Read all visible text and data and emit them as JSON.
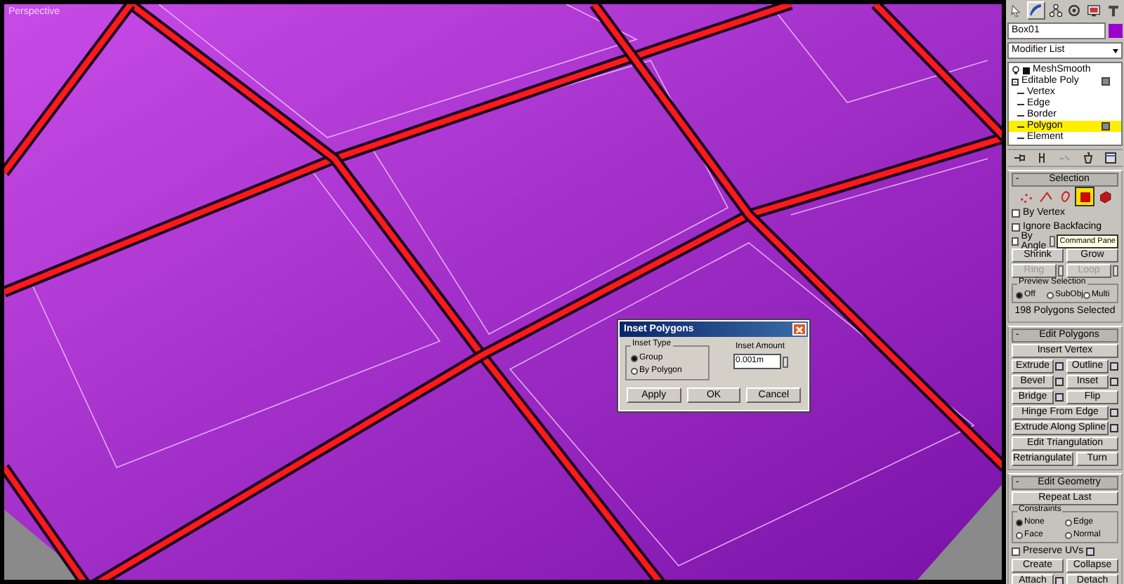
{
  "viewport": {
    "label": "Perspective"
  },
  "command_panel": {
    "tabs": [
      {
        "kind": "create",
        "selected": false
      },
      {
        "kind": "modify",
        "selected": true
      },
      {
        "kind": "hierarchy",
        "selected": false
      },
      {
        "kind": "motion",
        "selected": false
      },
      {
        "kind": "display",
        "selected": false
      },
      {
        "kind": "utilities",
        "selected": false
      }
    ],
    "object_name": "Box01",
    "modifier_list": "Modifier List",
    "stack": [
      {
        "label": "MeshSmooth",
        "kind": "modifier"
      },
      {
        "label": "Editable Poly",
        "kind": "base",
        "expanded": true,
        "children": [
          {
            "label": "Vertex",
            "selected": false
          },
          {
            "label": "Edge",
            "selected": false
          },
          {
            "label": "Border",
            "selected": false
          },
          {
            "label": "Polygon",
            "selected": true
          },
          {
            "label": "Element",
            "selected": false
          }
        ]
      }
    ],
    "rollouts": [
      {
        "kind": "selection",
        "toggle": "-",
        "title": "Selection",
        "levels": [
          {
            "kind": "vertex",
            "selected": false
          },
          {
            "kind": "edge",
            "selected": false
          },
          {
            "kind": "border",
            "selected": false
          },
          {
            "kind": "polygon",
            "selected": true
          },
          {
            "kind": "element",
            "selected": false
          }
        ],
        "checkboxes": [
          {
            "label": "By Vertex",
            "checked": false
          },
          {
            "label": "Ignore Backfacing",
            "checked": false
          },
          {
            "label": "By Angle",
            "checked": false
          }
        ],
        "tooltip": "Command Pane",
        "button_rows": [
          [
            {
              "label": "Shrink",
              "disabled": false
            },
            {
              "label": "Grow",
              "disabled": false
            }
          ],
          [
            {
              "label": "Ring",
              "disabled": true,
              "spinner": true
            },
            {
              "label": "Loop",
              "disabled": true,
              "spinner": true
            }
          ]
        ],
        "group": {
          "title": "Preview Selection",
          "options": [
            {
              "label": "Off",
              "selected": true
            },
            {
              "label": "SubObj",
              "selected": false
            },
            {
              "label": "Multi",
              "selected": false
            }
          ]
        },
        "status": "198 Polygons Selected"
      },
      {
        "kind": "edit_polygons",
        "toggle": "-",
        "title": "Edit Polygons",
        "button_rows": [
          [
            {
              "label": "Insert Vertex",
              "disabled": false
            }
          ],
          [
            {
              "label": "Extrude",
              "disabled": false,
              "settings": true
            },
            {
              "label": "Outline",
              "disabled": false,
              "settings": true
            }
          ],
          [
            {
              "label": "Bevel",
              "disabled": false,
              "settings": true
            },
            {
              "label": "Inset",
              "disabled": false,
              "settings": true
            }
          ],
          [
            {
              "label": "Bridge",
              "disabled": false,
              "settings": true
            },
            {
              "label": "Flip",
              "disabled": false
            }
          ],
          [
            {
              "label": "Hinge From Edge",
              "disabled": false,
              "settings": true
            }
          ],
          [
            {
              "label": "Extrude Along Spline",
              "disabled": false,
              "settings": true
            }
          ],
          [
            {
              "label": "Edit Triangulation",
              "disabled": false
            }
          ],
          [
            {
              "label": "Retriangulate",
              "disabled": false
            },
            {
              "label": "Turn",
              "disabled": false
            }
          ]
        ]
      },
      {
        "kind": "edit_geometry",
        "toggle": "-",
        "title": "Edit Geometry",
        "button_rows": [
          [
            {
              "label": "Repeat Last",
              "disabled": false
            }
          ]
        ],
        "group": {
          "title": "Constraints",
          "options": [
            {
              "label": "None",
              "selected": true
            },
            {
              "label": "Edge",
              "selected": false
            },
            {
              "label": "Face",
              "selected": false
            },
            {
              "label": "Normal",
              "selected": false
            }
          ]
        },
        "checkboxes": [
          {
            "label": "Preserve UVs",
            "checked": false,
            "settings": true
          }
        ],
        "button_rows_after": [
          [
            {
              "label": "Create",
              "disabled": false
            },
            {
              "label": "Collapse",
              "disabled": false
            }
          ],
          [
            {
              "label": "Attach",
              "disabled": false,
              "settings": true
            },
            {
              "label": "Detach",
              "disabled": false
            }
          ]
        ]
      }
    ]
  },
  "dialog": {
    "title": "Inset Polygons",
    "group": {
      "title": "Inset Type",
      "options": [
        {
          "label": "Group",
          "selected": true
        },
        {
          "label": "By Polygon",
          "selected": false
        }
      ]
    },
    "amount": {
      "label": "Inset Amount",
      "value": "0.001m"
    },
    "buttons": [
      "Apply",
      "OK",
      "Cancel"
    ]
  }
}
